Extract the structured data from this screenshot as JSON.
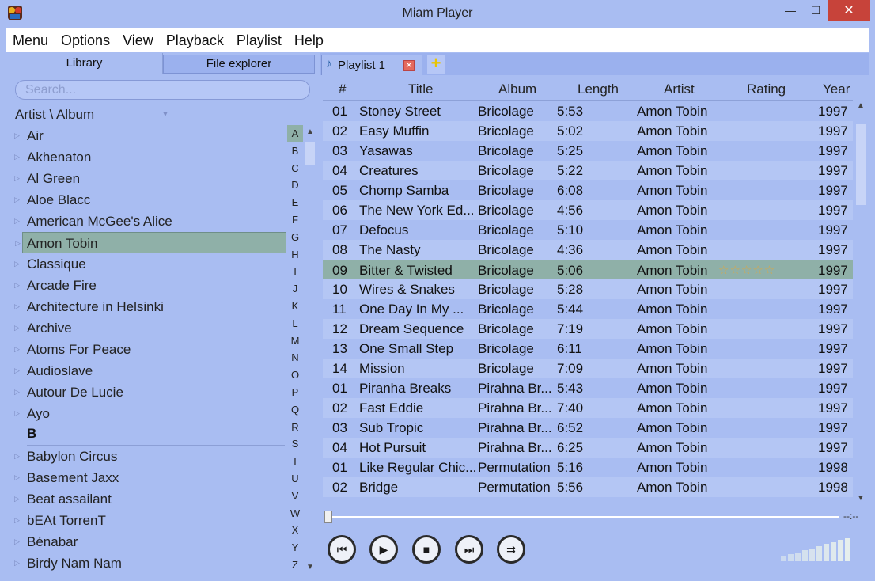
{
  "window": {
    "title": "Miam Player",
    "minimize_glyph": "—",
    "maximize_glyph": "☐",
    "close_glyph": "✕"
  },
  "menu": [
    "Menu",
    "Options",
    "View",
    "Playback",
    "Playlist",
    "Help"
  ],
  "library": {
    "tabs": {
      "library": "Library",
      "file_explorer": "File explorer"
    },
    "search_placeholder": "Search...",
    "group_by": "Artist \\ Album",
    "items_a": [
      "Air",
      "Akhenaton",
      "Al Green",
      "Aloe Blacc",
      "American McGee's Alice",
      "Amon Tobin",
      "Classique",
      "Arcade Fire",
      "Architecture in Helsinki",
      "Archive",
      "Atoms For Peace",
      "Audioslave",
      "Autour De Lucie",
      "Ayo"
    ],
    "letter_b": "B",
    "items_b": [
      "Babylon Circus",
      "Basement Jaxx",
      "Beat assailant",
      "bEAt TorrenT",
      "Bénabar",
      "Birdy Nam Nam"
    ],
    "selected": "Amon Tobin",
    "alphabet": [
      "A",
      "B",
      "C",
      "D",
      "E",
      "F",
      "G",
      "H",
      "I",
      "J",
      "K",
      "L",
      "M",
      "N",
      "O",
      "P",
      "Q",
      "R",
      "S",
      "T",
      "U",
      "V",
      "W",
      "X",
      "Y",
      "Z"
    ]
  },
  "playlist": {
    "tab": "Playlist 1",
    "columns": {
      "num": "#",
      "title": "Title",
      "album": "Album",
      "length": "Length",
      "artist": "Artist",
      "rating": "Rating",
      "year": "Year"
    },
    "tracks": [
      {
        "num": "01",
        "title": "Stoney Street",
        "album": "Bricolage",
        "length": "5:53",
        "artist": "Amon Tobin",
        "year": "1997"
      },
      {
        "num": "02",
        "title": "Easy Muffin",
        "album": "Bricolage",
        "length": "5:02",
        "artist": "Amon Tobin",
        "year": "1997"
      },
      {
        "num": "03",
        "title": "Yasawas",
        "album": "Bricolage",
        "length": "5:25",
        "artist": "Amon Tobin",
        "year": "1997"
      },
      {
        "num": "04",
        "title": "Creatures",
        "album": "Bricolage",
        "length": "5:22",
        "artist": "Amon Tobin",
        "year": "1997"
      },
      {
        "num": "05",
        "title": "Chomp Samba",
        "album": "Bricolage",
        "length": "6:08",
        "artist": "Amon Tobin",
        "year": "1997"
      },
      {
        "num": "06",
        "title": "The New York Ed...",
        "album": "Bricolage",
        "length": "4:56",
        "artist": "Amon Tobin",
        "year": "1997"
      },
      {
        "num": "07",
        "title": "Defocus",
        "album": "Bricolage",
        "length": "5:10",
        "artist": "Amon Tobin",
        "year": "1997"
      },
      {
        "num": "08",
        "title": "The Nasty",
        "album": "Bricolage",
        "length": "4:36",
        "artist": "Amon Tobin",
        "year": "1997"
      },
      {
        "num": "09",
        "title": "Bitter & Twisted",
        "album": "Bricolage",
        "length": "5:06",
        "artist": "Amon Tobin",
        "rating": "☆☆☆☆☆",
        "year": "1997"
      },
      {
        "num": "10",
        "title": "Wires & Snakes",
        "album": "Bricolage",
        "length": "5:28",
        "artist": "Amon Tobin",
        "year": "1997"
      },
      {
        "num": "11",
        "title": "One Day In My ...",
        "album": "Bricolage",
        "length": "5:44",
        "artist": "Amon Tobin",
        "year": "1997"
      },
      {
        "num": "12",
        "title": "Dream Sequence",
        "album": "Bricolage",
        "length": "7:19",
        "artist": "Amon Tobin",
        "year": "1997"
      },
      {
        "num": "13",
        "title": "One Small Step",
        "album": "Bricolage",
        "length": "6:11",
        "artist": "Amon Tobin",
        "year": "1997"
      },
      {
        "num": "14",
        "title": "Mission",
        "album": "Bricolage",
        "length": "7:09",
        "artist": "Amon Tobin",
        "year": "1997"
      },
      {
        "num": "01",
        "title": "Piranha Breaks",
        "album": "Pirahna Br...",
        "length": "5:43",
        "artist": "Amon Tobin",
        "year": "1997"
      },
      {
        "num": "02",
        "title": "Fast Eddie",
        "album": "Pirahna Br...",
        "length": "7:40",
        "artist": "Amon Tobin",
        "year": "1997"
      },
      {
        "num": "03",
        "title": "Sub Tropic",
        "album": "Pirahna Br...",
        "length": "6:52",
        "artist": "Amon Tobin",
        "year": "1997"
      },
      {
        "num": "04",
        "title": "Hot Pursuit",
        "album": "Pirahna Br...",
        "length": "6:25",
        "artist": "Amon Tobin",
        "year": "1997"
      },
      {
        "num": "01",
        "title": "Like Regular Chic...",
        "album": "Permutation",
        "length": "5:16",
        "artist": "Amon Tobin",
        "year": "1998"
      },
      {
        "num": "02",
        "title": "Bridge",
        "album": "Permutation",
        "length": "5:56",
        "artist": "Amon Tobin",
        "year": "1998"
      }
    ],
    "selected_index": 8
  },
  "player": {
    "time": "--:--",
    "seek_position": 0.0,
    "volume_bars": 10
  },
  "colors": {
    "background": "#a9bdf2",
    "selection": "#8fb0a8",
    "close_button": "#c7433a"
  }
}
